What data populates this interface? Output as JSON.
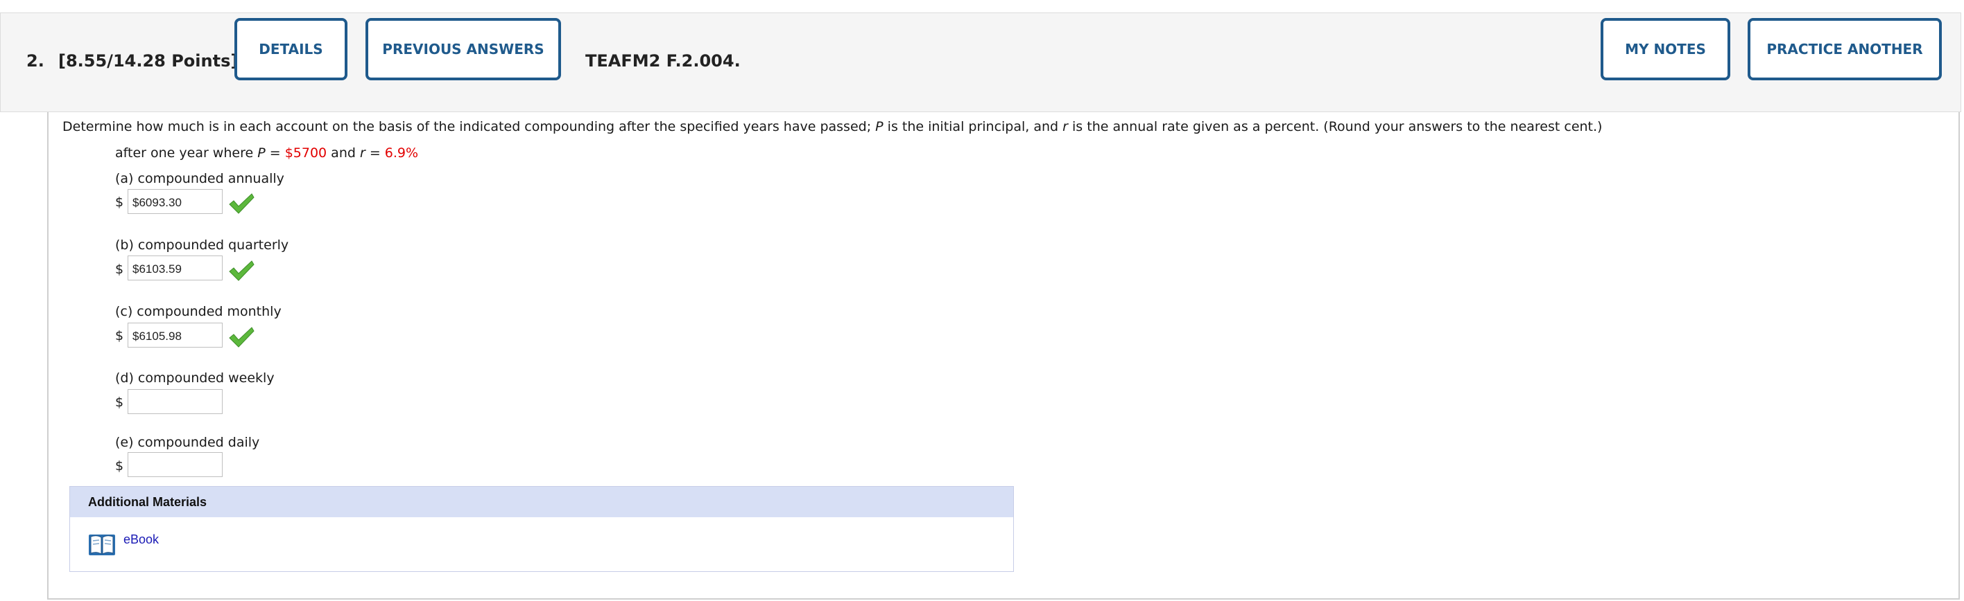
{
  "header": {
    "question_number": "2.",
    "points": "[8.55/14.28 Points]",
    "details_label": "DETAILS",
    "previous_answers_label": "PREVIOUS ANSWERS",
    "question_code": "TEAFM2 F.2.004.",
    "my_notes_label": "MY NOTES",
    "practice_another_label": "PRACTICE ANOTHER"
  },
  "question": {
    "prompt_a": "Determine how much is in each account on the basis of the indicated compounding after the specified years have passed; ",
    "var_p": "P",
    "prompt_b": " is the initial principal, and ",
    "var_r": "r",
    "prompt_c": " is the annual rate given as a percent. (Round your answers to the nearest cent.)",
    "cond_a": "after one year where ",
    "cond_eq1": " = ",
    "principal": "$5700",
    "cond_and": " and ",
    "cond_eq2": " = ",
    "rate": "6.9%"
  },
  "parts": [
    {
      "label": "(a) compounded annually",
      "currency": "$",
      "value": "$6093.30",
      "status": "correct"
    },
    {
      "label": "(b) compounded quarterly",
      "currency": "$",
      "value": "$6103.59",
      "status": "correct"
    },
    {
      "label": "(c) compounded monthly",
      "currency": "$",
      "value": "$6105.98",
      "status": "correct"
    },
    {
      "label": "(d) compounded weekly",
      "currency": "$",
      "value": "",
      "status": "unanswered"
    },
    {
      "label": "(e) compounded daily",
      "currency": "$",
      "value": "",
      "status": "unanswered"
    }
  ],
  "additional_materials": {
    "heading": "Additional Materials",
    "ebook_label": "eBook",
    "ebook_icon": "book-icon"
  },
  "colors": {
    "accent": "#1f5a8c",
    "given_value": "#e20000",
    "check": "#5cb83c",
    "link": "#1a1ab5",
    "materials_header": "#d7dff5"
  }
}
